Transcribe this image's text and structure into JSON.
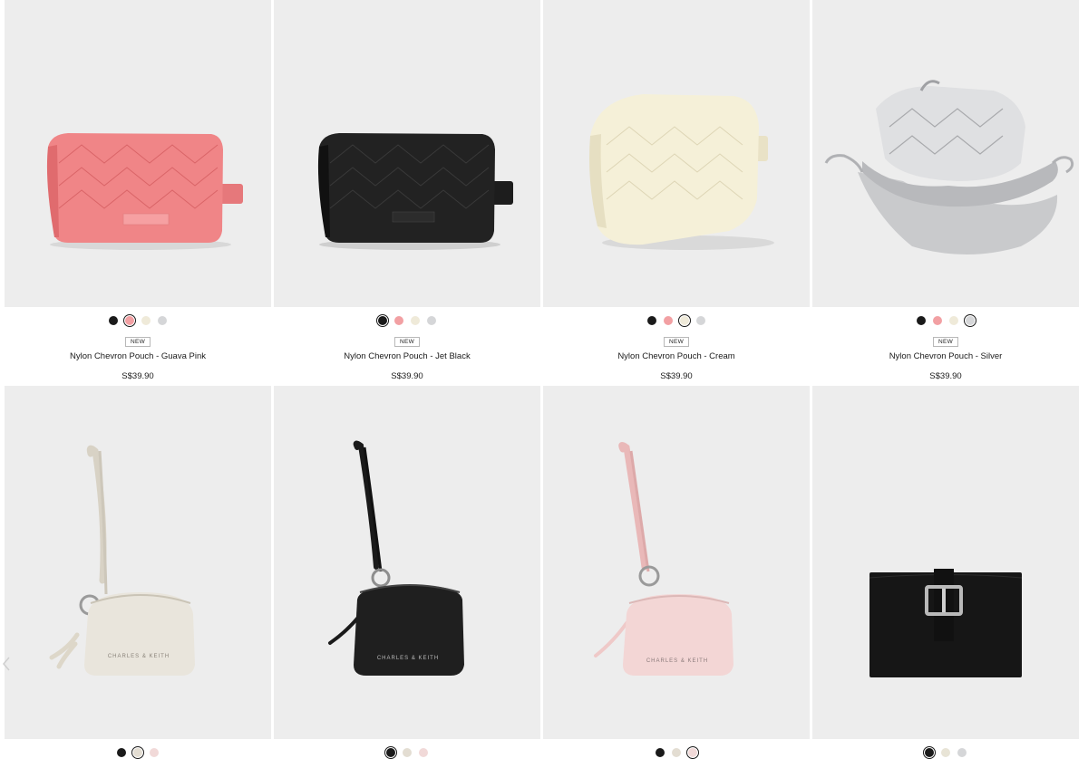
{
  "colors": {
    "black": "#1a1a1a",
    "pink": "#f2a0a3",
    "cream": "#efead9",
    "silver": "#d5d6d8",
    "light_pink": "#f1d9d8",
    "taupe": "#e3ddd2"
  },
  "products_row1": [
    {
      "badge": "NEW",
      "name": "Nylon Chevron Pouch - Guava Pink",
      "price": "S$39.90",
      "image_icon": "guava-pink-pouch-image",
      "swatches": [
        {
          "color": "#1a1a1a",
          "selected": false
        },
        {
          "color": "#f2a0a3",
          "selected": true
        },
        {
          "color": "#efead9",
          "selected": false
        },
        {
          "color": "#d5d6d8",
          "selected": false
        }
      ]
    },
    {
      "badge": "NEW",
      "name": "Nylon Chevron Pouch - Jet Black",
      "price": "S$39.90",
      "image_icon": "jet-black-pouch-image",
      "swatches": [
        {
          "color": "#1a1a1a",
          "selected": true
        },
        {
          "color": "#f2a0a3",
          "selected": false
        },
        {
          "color": "#efead9",
          "selected": false
        },
        {
          "color": "#d5d6d8",
          "selected": false
        }
      ]
    },
    {
      "badge": "NEW",
      "name": "Nylon Chevron Pouch - Cream",
      "price": "S$39.90",
      "image_icon": "cream-pouch-image",
      "swatches": [
        {
          "color": "#1a1a1a",
          "selected": false
        },
        {
          "color": "#f2a0a3",
          "selected": false
        },
        {
          "color": "#efead9",
          "selected": true
        },
        {
          "color": "#d5d6d8",
          "selected": false
        }
      ]
    },
    {
      "badge": "NEW",
      "name": "Nylon Chevron Pouch - Silver",
      "price": "S$39.90",
      "image_icon": "silver-pouch-image",
      "swatches": [
        {
          "color": "#1a1a1a",
          "selected": false
        },
        {
          "color": "#f2a0a3",
          "selected": false
        },
        {
          "color": "#efead9",
          "selected": false
        },
        {
          "color": "#d5d6d8",
          "selected": true
        }
      ]
    }
  ],
  "products_row2": [
    {
      "image_icon": "cream-mini-pouch-image",
      "swatches": [
        {
          "color": "#1a1a1a",
          "selected": false
        },
        {
          "color": "#e3ddd2",
          "selected": true
        },
        {
          "color": "#f1d9d8",
          "selected": false
        }
      ]
    },
    {
      "image_icon": "black-mini-pouch-image",
      "swatches": [
        {
          "color": "#1a1a1a",
          "selected": true
        },
        {
          "color": "#e3ddd2",
          "selected": false
        },
        {
          "color": "#f1d9d8",
          "selected": false
        }
      ]
    },
    {
      "image_icon": "pink-mini-pouch-image",
      "swatches": [
        {
          "color": "#1a1a1a",
          "selected": false
        },
        {
          "color": "#e3ddd2",
          "selected": false
        },
        {
          "color": "#f1d9d8",
          "selected": true
        }
      ]
    },
    {
      "image_icon": "black-wallet-image",
      "swatches": [
        {
          "color": "#1a1a1a",
          "selected": true
        },
        {
          "color": "#e8e4d6",
          "selected": false
        },
        {
          "color": "#d5d6d8",
          "selected": false
        }
      ]
    }
  ],
  "brand_text": "CHARLES & KEITH"
}
